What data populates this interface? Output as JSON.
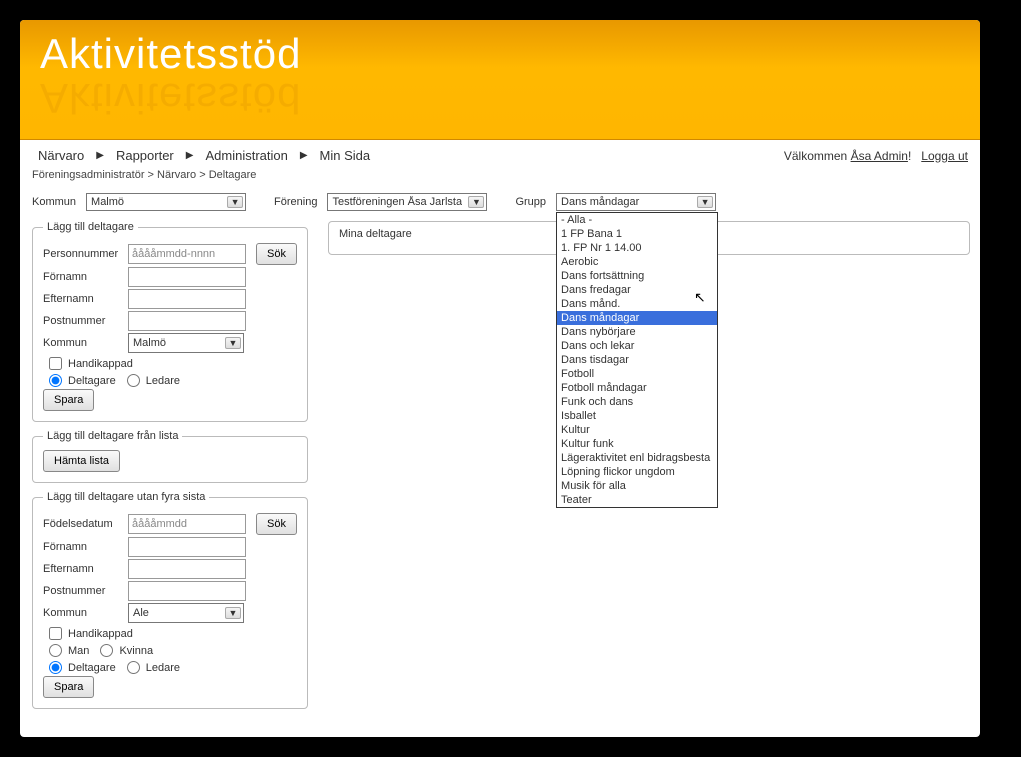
{
  "header": {
    "logo": "Aktivitetsstöd"
  },
  "nav": {
    "items": [
      "Närvaro",
      "Rapporter",
      "Administration",
      "Min Sida"
    ],
    "welcome_prefix": "Välkommen ",
    "user": "Åsa Admin",
    "logout": "Logga ut"
  },
  "breadcrumb": "Föreningsadministratör > Närvaro > Deltagare",
  "filters": {
    "kommun_label": "Kommun",
    "kommun_value": "Malmö",
    "forening_label": "Förening",
    "forening_value": "Testföreningen Åsa Jarlstam",
    "grupp_label": "Grupp",
    "grupp_value": "Dans måndagar",
    "grupp_options": [
      "- Alla -",
      "1 FP Bana 1",
      "1. FP Nr 1 14.00",
      "Aerobic",
      "Dans fortsättning",
      "Dans fredagar",
      "Dans månd.",
      "Dans måndagar",
      "Dans nybörjare",
      "Dans och lekar",
      "Dans tisdagar",
      "Fotboll",
      "Fotboll måndagar",
      "Funk och dans",
      "Isballet",
      "Kultur",
      "Kultur funk",
      "Lägeraktivitet enl bidragsbesta",
      "Löpning flickor ungdom",
      "Musik för alla",
      "Teater"
    ],
    "grupp_highlight": "Dans måndagar"
  },
  "panels": {
    "p1_legend": "Lägg till deltagare",
    "p2_legend": "Lägg till deltagare från lista",
    "p3_legend": "Lägg till deltagare utan fyra sista"
  },
  "form": {
    "personnummer": "Personnummer",
    "personnummer_ph": "ååååmmdd-nnnn",
    "fodelsedatum": "Födelsedatum",
    "fodelsedatum_ph": "ååååmmdd",
    "fornamn": "Förnamn",
    "efternamn": "Efternamn",
    "postnummer": "Postnummer",
    "kommun": "Kommun",
    "kommun_val1": "Malmö",
    "kommun_val2": "Ale",
    "handikappad": "Handikappad",
    "deltagare": "Deltagare",
    "ledare": "Ledare",
    "man": "Man",
    "kvinna": "Kvinna",
    "sok": "Sök",
    "spara": "Spara",
    "hamta": "Hämta lista"
  },
  "right": {
    "mina_deltagare": "Mina deltagare"
  }
}
